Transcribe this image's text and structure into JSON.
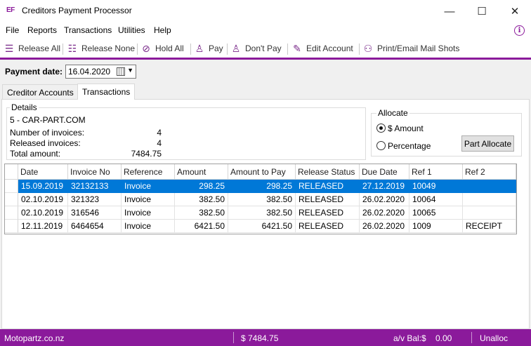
{
  "window": {
    "app_icon": "EF",
    "title": "Creditors Payment Processor",
    "minimize": "—",
    "maximize": "☐",
    "close": "✕"
  },
  "menu": {
    "items": [
      "File",
      "Reports",
      "Transactions",
      "Utilities",
      "Help"
    ],
    "info_icon": "i"
  },
  "toolbar": {
    "buttons": [
      {
        "label": "Release All",
        "icon": "check-list-icon"
      },
      {
        "label": "Release None",
        "icon": "list-icon"
      },
      {
        "label": "Hold All",
        "icon": "prohibited-icon"
      },
      {
        "label": "Pay",
        "icon": "person-check-icon"
      },
      {
        "label": "Don't Pay",
        "icon": "person-minus-icon"
      },
      {
        "label": "Edit Account",
        "icon": "pencil-icon"
      },
      {
        "label": "Print/Email Mail Shots",
        "icon": "people-icon"
      }
    ]
  },
  "payment": {
    "label": "Payment date:",
    "date": "16.04.2020"
  },
  "tabs": [
    "Creditor Accounts",
    "Transactions"
  ],
  "details": {
    "legend": "Details",
    "account": "5 - CAR-PART.COM",
    "rows": [
      {
        "label": "Number of invoices:",
        "value": "4"
      },
      {
        "label": "Released invoices:",
        "value": "4"
      },
      {
        "label": "Total amount:",
        "value": "7484.75"
      }
    ]
  },
  "allocate": {
    "legend": "Allocate",
    "option_amount": "$ Amount",
    "option_percentage": "Percentage",
    "selected": "$ Amount",
    "part_allocate": "Part Allocate"
  },
  "grid": {
    "columns": [
      "Date",
      "Invoice No",
      "Reference",
      "Amount",
      "Amount to Pay",
      "Release Status",
      "Due Date",
      "Ref 1",
      "Ref 2"
    ],
    "rows": [
      [
        "15.09.2019",
        "32132133",
        "Invoice",
        "298.25",
        "298.25",
        "RELEASED",
        "27.12.2019",
        "10049",
        ""
      ],
      [
        "02.10.2019",
        "321323",
        "Invoice",
        "382.50",
        "382.50",
        "RELEASED",
        "26.02.2020",
        "10064",
        ""
      ],
      [
        "02.10.2019",
        "316546",
        "Invoice",
        "382.50",
        "382.50",
        "RELEASED",
        "26.02.2020",
        "10065",
        ""
      ],
      [
        "12.11.2019",
        "6464654",
        "Invoice",
        "6421.50",
        "6421.50",
        "RELEASED",
        "26.02.2020",
        "1009",
        "RECEIPT"
      ]
    ],
    "selected_row": 0
  },
  "status": {
    "company": "Motopartz.co.nz",
    "total": "$  7484.75",
    "avbal_label": "a/v Bal:$",
    "avbal_value": "0.00",
    "unalloc": "Unalloc"
  },
  "colors": {
    "accent": "#8b1a9b",
    "selection": "#0078d7"
  }
}
